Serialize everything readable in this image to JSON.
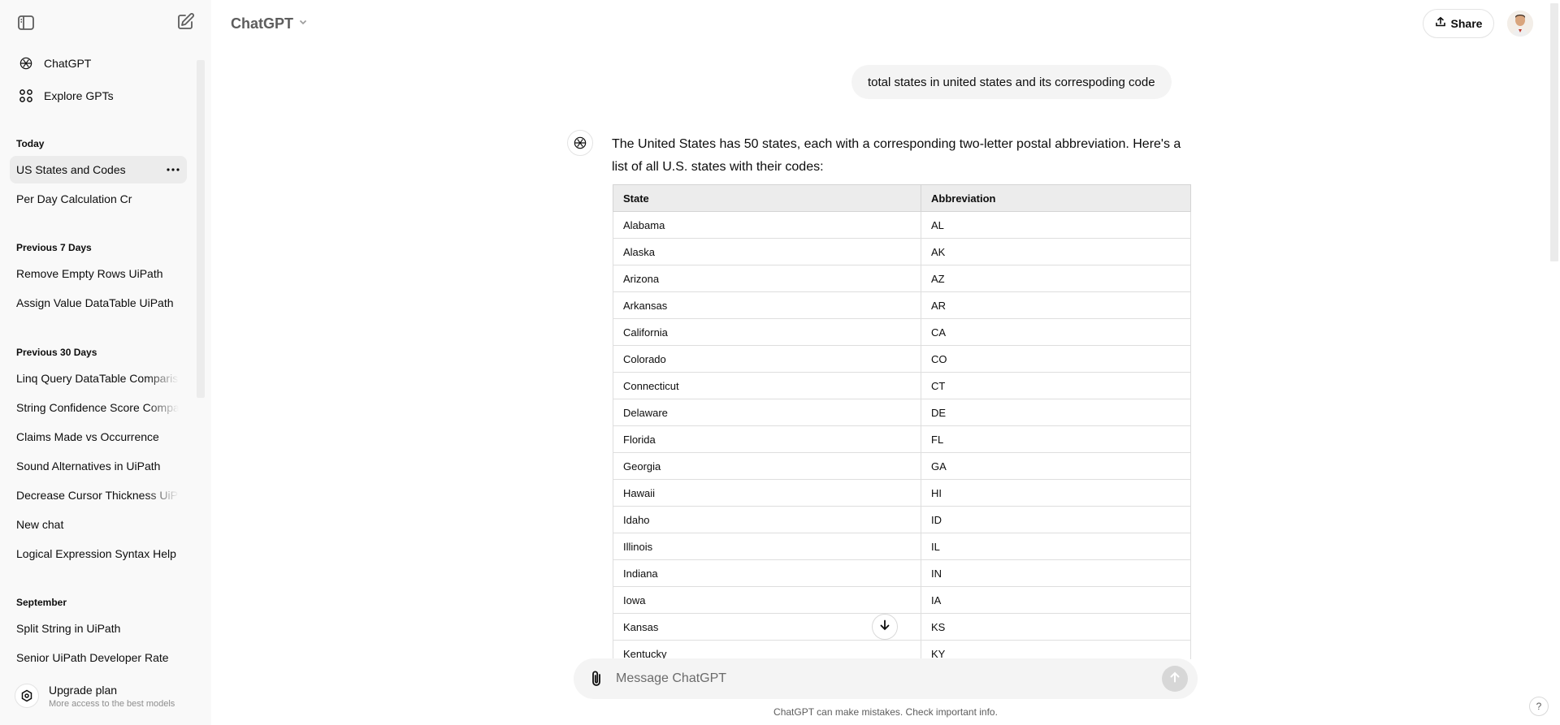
{
  "sidebar": {
    "nav": [
      {
        "label": "ChatGPT",
        "icon": "openai-logo-icon"
      },
      {
        "label": "Explore GPTs",
        "icon": "grid-icon"
      }
    ],
    "sections": [
      {
        "title": "Today",
        "items": [
          "US States and Codes",
          "Per Day Calculation Cr"
        ]
      },
      {
        "title": "Previous 7 Days",
        "items": [
          "Remove Empty Rows UiPath",
          "Assign Value DataTable UiPath"
        ]
      },
      {
        "title": "Previous 30 Days",
        "items": [
          "Linq Query DataTable Compariso",
          "String Confidence Score Compar",
          "Claims Made vs Occurrence",
          "Sound Alternatives in UiPath",
          "Decrease Cursor Thickness UiPat",
          "New chat",
          "Logical Expression Syntax Help"
        ]
      },
      {
        "title": "September",
        "items": [
          "Split String in UiPath",
          "Senior UiPath Developer Rate"
        ]
      }
    ],
    "active_item": "US States and Codes",
    "upgrade": {
      "title": "Upgrade plan",
      "subtitle": "More access to the best models"
    }
  },
  "header": {
    "model": "ChatGPT",
    "share_label": "Share"
  },
  "conversation": {
    "user_message": "total states in united states and its correspoding code",
    "assistant_intro": "The United States has 50 states, each with a corresponding two-letter postal abbreviation. Here's a list of all U.S. states with their codes:",
    "table": {
      "headers": [
        "State",
        "Abbreviation"
      ],
      "rows": [
        [
          "Alabama",
          "AL"
        ],
        [
          "Alaska",
          "AK"
        ],
        [
          "Arizona",
          "AZ"
        ],
        [
          "Arkansas",
          "AR"
        ],
        [
          "California",
          "CA"
        ],
        [
          "Colorado",
          "CO"
        ],
        [
          "Connecticut",
          "CT"
        ],
        [
          "Delaware",
          "DE"
        ],
        [
          "Florida",
          "FL"
        ],
        [
          "Georgia",
          "GA"
        ],
        [
          "Hawaii",
          "HI"
        ],
        [
          "Idaho",
          "ID"
        ],
        [
          "Illinois",
          "IL"
        ],
        [
          "Indiana",
          "IN"
        ],
        [
          "Iowa",
          "IA"
        ],
        [
          "Kansas",
          "KS"
        ],
        [
          "Kentucky",
          "KY"
        ]
      ]
    }
  },
  "composer": {
    "placeholder": "Message ChatGPT",
    "disclaimer": "ChatGPT can make mistakes. Check important info."
  },
  "help_label": "?",
  "colors": {
    "sidebar_bg": "#f9f9f9",
    "active_item_bg": "#ececec",
    "bubble_bg": "#f4f4f4",
    "table_header_bg": "#ececec"
  }
}
